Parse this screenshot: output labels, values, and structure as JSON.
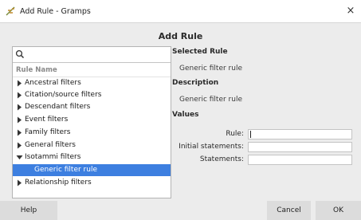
{
  "window": {
    "title": "Add Rule - Gramps",
    "close_glyph": "×",
    "icon": "gramps-tree-icon"
  },
  "dialog": {
    "heading": "Add Rule"
  },
  "search": {
    "value": "",
    "icon": "search-icon"
  },
  "tree": {
    "column_header": "Rule Name",
    "items": [
      {
        "label": "Ancestral filters",
        "expanded": false
      },
      {
        "label": "Citation/source filters",
        "expanded": false
      },
      {
        "label": "Descendant filters",
        "expanded": false
      },
      {
        "label": "Event filters",
        "expanded": false
      },
      {
        "label": "Family filters",
        "expanded": false
      },
      {
        "label": "General filters",
        "expanded": false
      },
      {
        "label": "Isotammi filters",
        "expanded": true
      },
      {
        "label": "Generic filter rule",
        "child": true,
        "selected": true
      },
      {
        "label": "Relationship filters",
        "expanded": false
      }
    ]
  },
  "details": {
    "selected_rule_heading": "Selected Rule",
    "selected_rule_value": "Generic filter rule",
    "description_heading": "Description",
    "description_value": "Generic filter rule",
    "values_heading": "Values",
    "fields": [
      {
        "label": "Rule:",
        "value": ""
      },
      {
        "label": "Initial statements:",
        "value": ""
      },
      {
        "label": "Statements:",
        "value": ""
      }
    ]
  },
  "buttons": {
    "help": "Help",
    "cancel": "Cancel",
    "ok": "OK"
  },
  "colors": {
    "selection": "#3d7fe0",
    "background": "#ececec",
    "button": "#dcdcdc"
  }
}
